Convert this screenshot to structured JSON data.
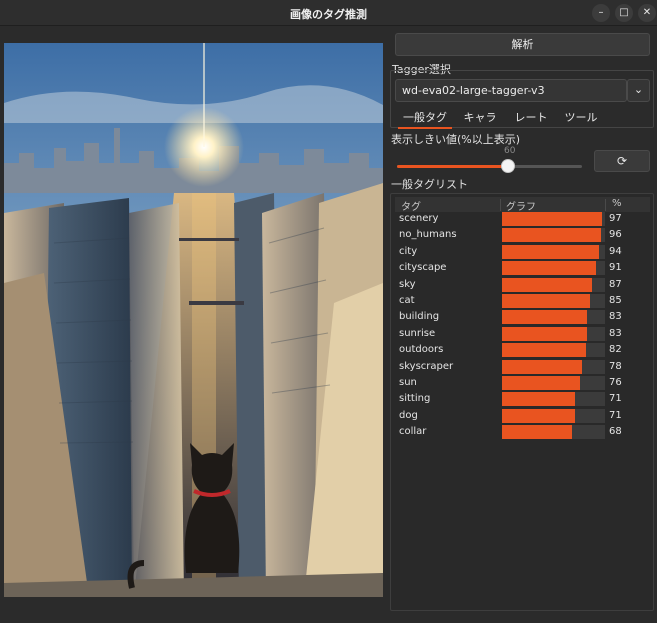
{
  "window": {
    "title": "画像のタグ推測"
  },
  "buttons": {
    "analyze": "解析",
    "reset": "⟳"
  },
  "tagger": {
    "label": "Tagger選択",
    "selected": "wd-eva02-large-tagger-v3"
  },
  "tabs": [
    {
      "label": "一般タグ",
      "active": true
    },
    {
      "label": "キャラ",
      "active": false
    },
    {
      "label": "レート",
      "active": false
    },
    {
      "label": "ツール",
      "active": false
    }
  ],
  "threshold": {
    "label": "表示しきい値(%以上表示)",
    "value": 60
  },
  "tag_list": {
    "label": "一般タグリスト",
    "columns": [
      "タグ",
      "グラフ",
      "%"
    ],
    "accent": "#e95420",
    "rows": [
      {
        "tag": "scenery",
        "pct": 97
      },
      {
        "tag": "no_humans",
        "pct": 96
      },
      {
        "tag": "city",
        "pct": 94
      },
      {
        "tag": "cityscape",
        "pct": 91
      },
      {
        "tag": "sky",
        "pct": 87
      },
      {
        "tag": "cat",
        "pct": 85
      },
      {
        "tag": "building",
        "pct": 83
      },
      {
        "tag": "sunrise",
        "pct": 83
      },
      {
        "tag": "outdoors",
        "pct": 82
      },
      {
        "tag": "skyscraper",
        "pct": 78
      },
      {
        "tag": "sun",
        "pct": 76
      },
      {
        "tag": "sitting",
        "pct": 71
      },
      {
        "tag": "dog",
        "pct": 71
      },
      {
        "tag": "collar",
        "pct": 68
      }
    ]
  }
}
